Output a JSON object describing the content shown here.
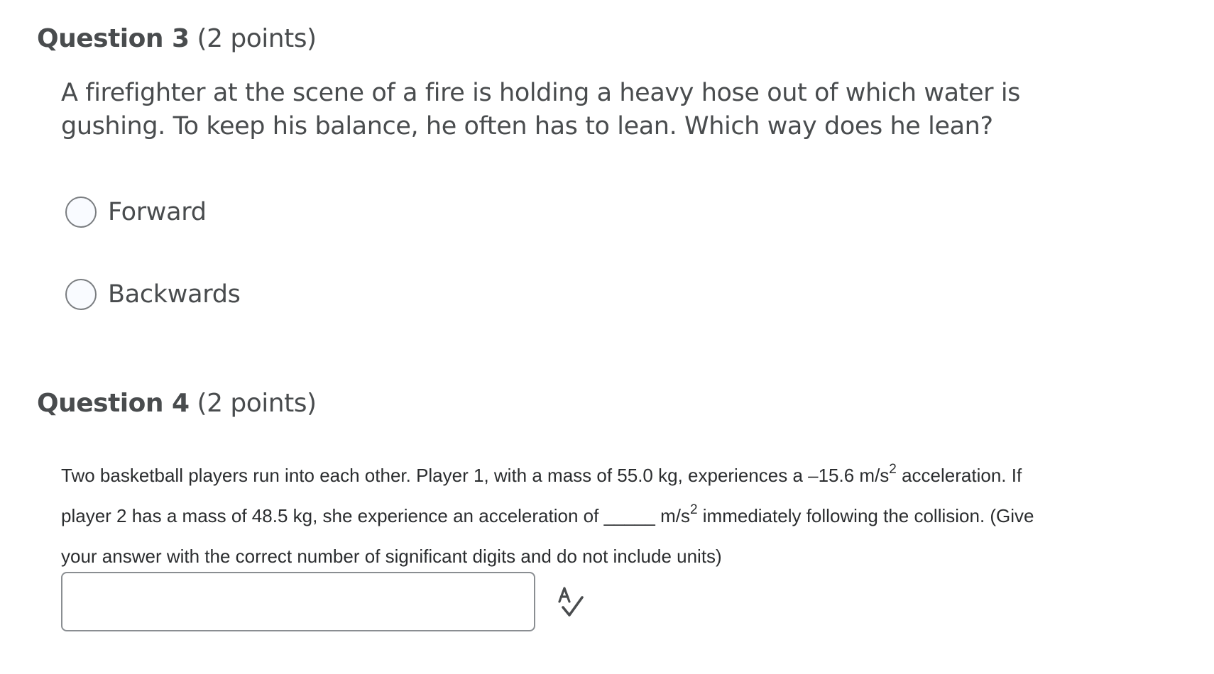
{
  "question3": {
    "heading_num": "Question 3",
    "heading_points": "(2 points)",
    "prompt": "A firefighter at the scene of a fire is holding a heavy hose out of which water is gushing. To keep his balance, he often has to lean. Which way does he lean?",
    "choices": [
      {
        "label": "Forward",
        "selected": false
      },
      {
        "label": "Backwards",
        "selected": false
      }
    ]
  },
  "question4": {
    "heading_num": "Question 4",
    "heading_points": "(2 points)",
    "prompt": {
      "line1_a": "Two basketball players run into each other. Player 1, with a mass of 55.0 kg, experiences a –15.6 m/s",
      "line1_sup": "2",
      "line1_b": " acceleration. If",
      "line2_a": "player 2 has a mass of 48.5 kg, she experience an acceleration of _____ m/s",
      "line2_sup": "2",
      "line2_b": " immediately following the collision. (Give",
      "line3": "your answer with the correct number of significant digits and do not include units)"
    },
    "answer": {
      "value": "",
      "placeholder": ""
    },
    "spellcheck_icon": "spellcheck-icon"
  },
  "colors": {
    "text": "#494c4e",
    "body_text": "#2b2d2f",
    "border": "#8a8e92",
    "radio_fill": "#f9fbff"
  }
}
